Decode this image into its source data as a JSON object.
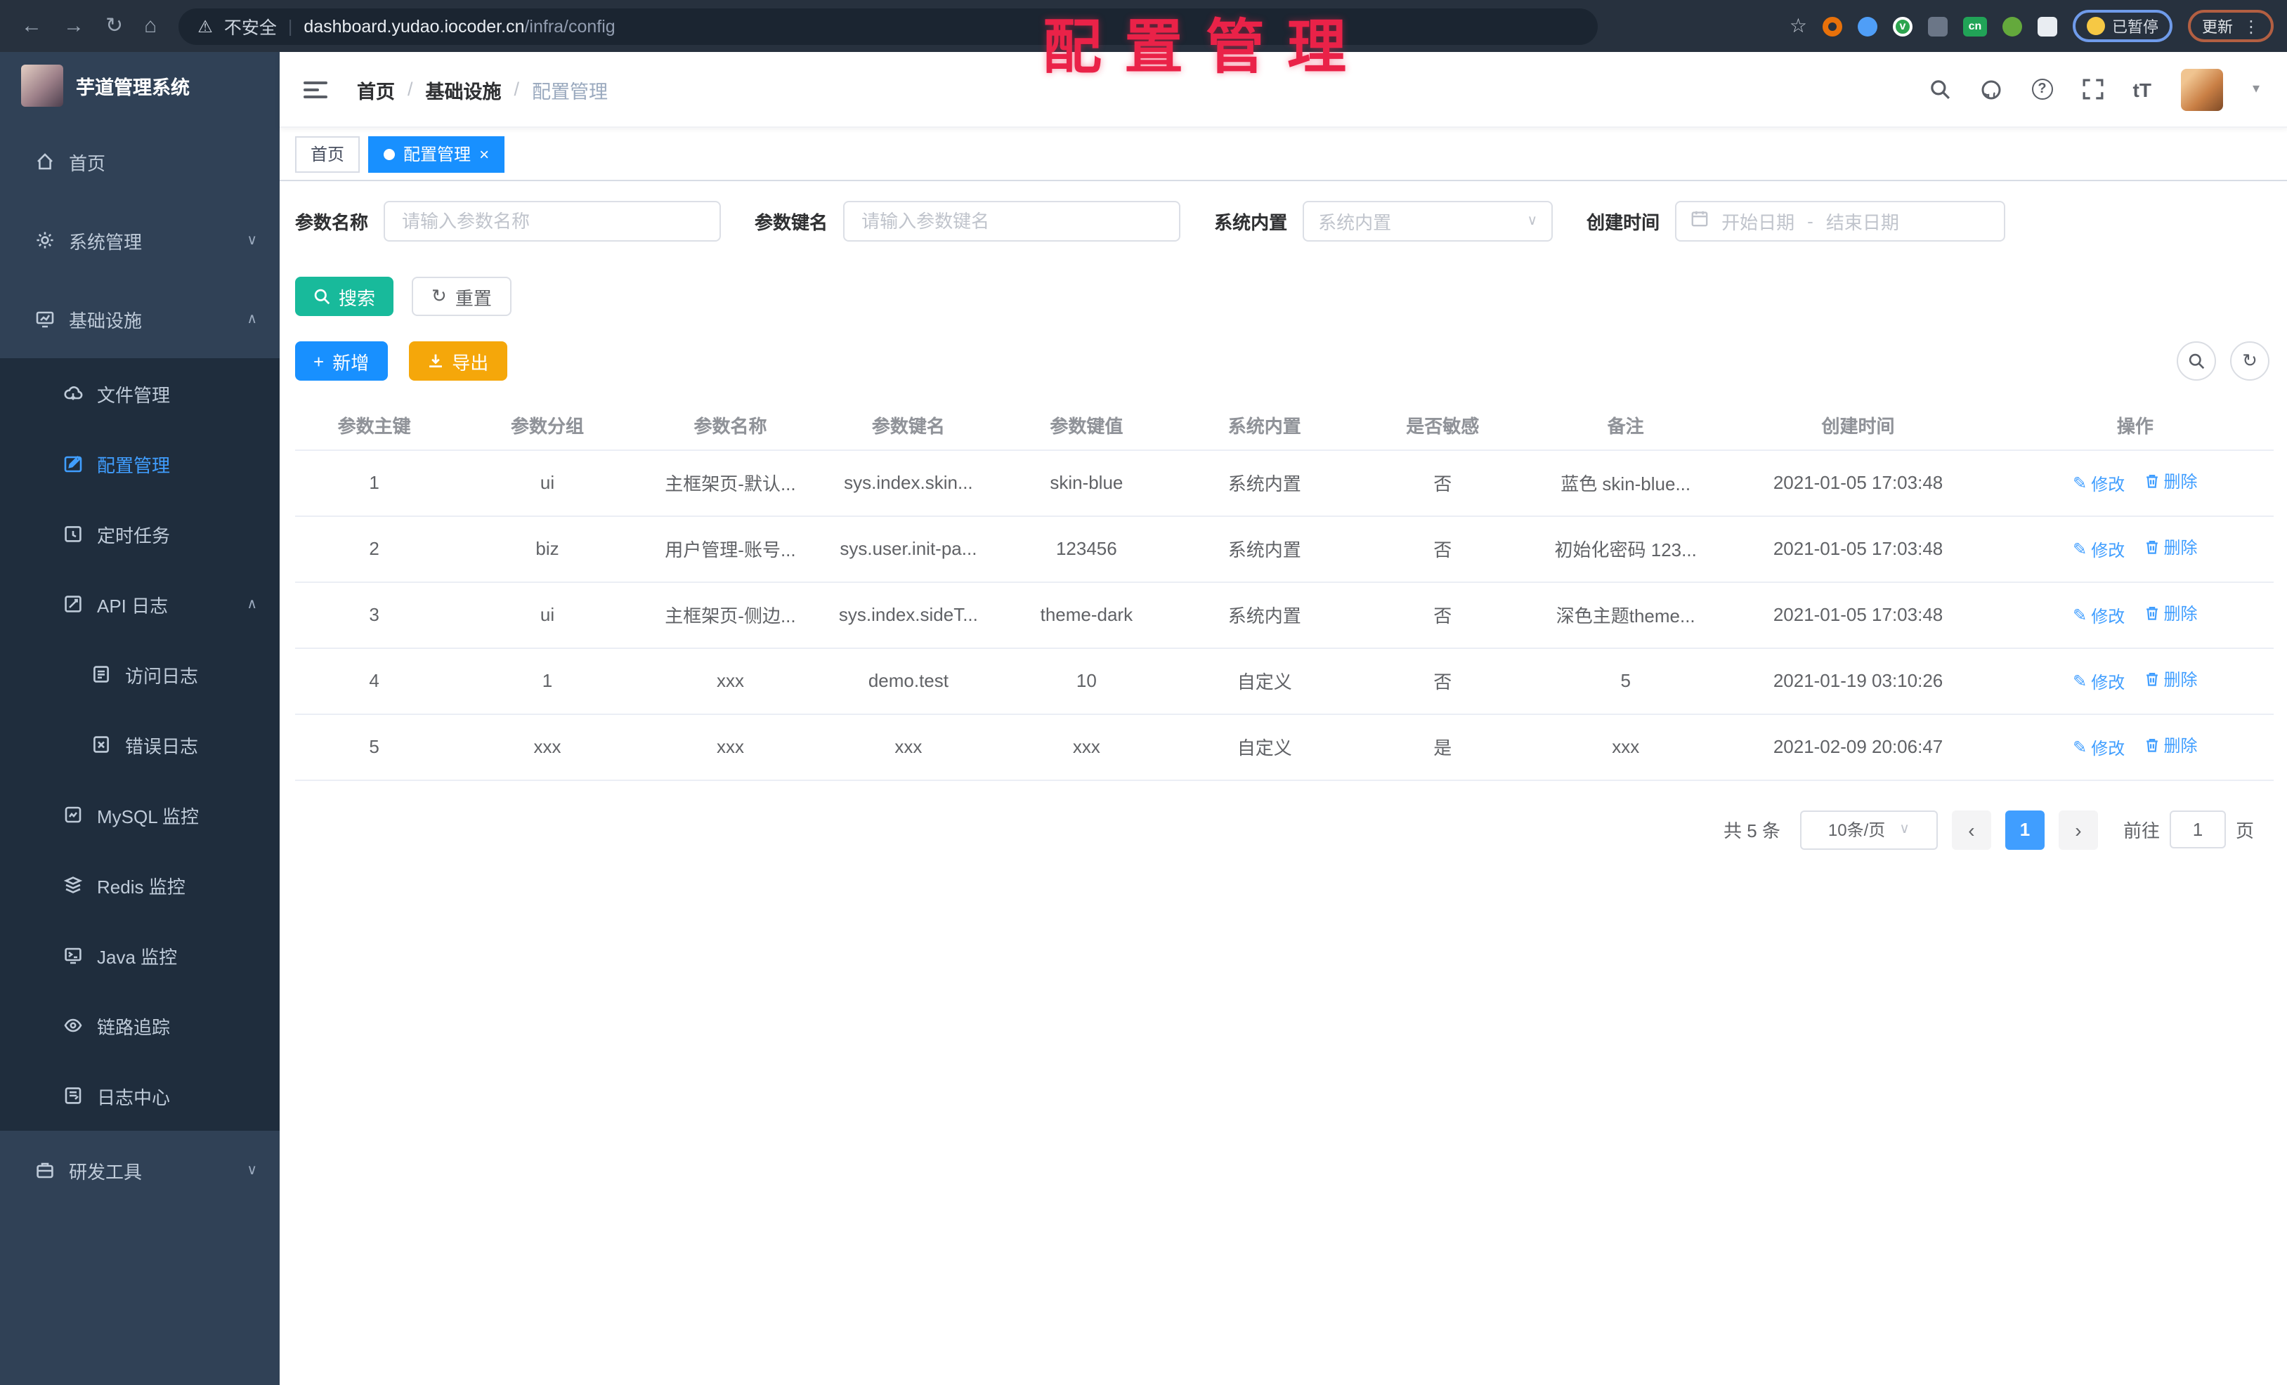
{
  "browser": {
    "security_label": "不安全",
    "url_host": "dashboard.yudao.iocoder.cn",
    "url_path": "/infra/config",
    "cn_badge": "cn",
    "paused_badge": "已暂停",
    "update_button": "更新"
  },
  "overlay": {
    "title": "配置管理"
  },
  "glyphs": {
    "back": "←",
    "forward": "→",
    "reload": "↻",
    "home": "⌂",
    "warning": "⚠",
    "pill_divider": "|",
    "star": "☆",
    "menu_dots": "⋮",
    "chevron_down": "∨",
    "chevron_up": "∧",
    "select_caret": "∨",
    "dropdown_caret": "▾",
    "prev": "‹",
    "next": "›",
    "close": "×",
    "plus": "+",
    "edit": "✎",
    "question": "?",
    "font_size": "tT",
    "breadcrumb_sep": "/",
    "check": "v"
  },
  "sidebar": {
    "app_title": "芋道管理系统",
    "items": [
      {
        "label": "首页"
      },
      {
        "label": "系统管理"
      },
      {
        "label": "基础设施"
      },
      {
        "label": "文件管理"
      },
      {
        "label": "配置管理"
      },
      {
        "label": "定时任务"
      },
      {
        "label": "API 日志"
      },
      {
        "label": "访问日志"
      },
      {
        "label": "错误日志"
      },
      {
        "label": "MySQL 监控"
      },
      {
        "label": "Redis 监控"
      },
      {
        "label": "Java 监控"
      },
      {
        "label": "链路追踪"
      },
      {
        "label": "日志中心"
      },
      {
        "label": "研发工具"
      }
    ]
  },
  "header": {
    "breadcrumb": [
      "首页",
      "基础设施",
      "配置管理"
    ]
  },
  "tabs": [
    {
      "label": "首页"
    },
    {
      "label": "配置管理"
    }
  ],
  "filters": {
    "name_label": "参数名称",
    "name_placeholder": "请输入参数名称",
    "key_label": "参数键名",
    "key_placeholder": "请输入参数键名",
    "type_label": "系统内置",
    "type_placeholder": "系统内置",
    "date_label": "创建时间",
    "date_start": "开始日期",
    "date_sep": "-",
    "date_end": "结束日期",
    "search_label": "搜索",
    "reset_label": "重置"
  },
  "toolbar": {
    "add_label": "新增",
    "export_label": "导出"
  },
  "table": {
    "columns": [
      "参数主键",
      "参数分组",
      "参数名称",
      "参数键名",
      "参数键值",
      "系统内置",
      "是否敏感",
      "备注",
      "创建时间",
      "操作"
    ],
    "edit_label": "修改",
    "delete_label": "删除",
    "rows": [
      {
        "id": "1",
        "group": "ui",
        "name": "主框架页-默认...",
        "key": "sys.index.skin...",
        "value": "skin-blue",
        "type": "系统内置",
        "sensitive": "否",
        "remark": "蓝色 skin-blue...",
        "created": "2021-01-05 17:03:48"
      },
      {
        "id": "2",
        "group": "biz",
        "name": "用户管理-账号...",
        "key": "sys.user.init-pa...",
        "value": "123456",
        "type": "系统内置",
        "sensitive": "否",
        "remark": "初始化密码 123...",
        "created": "2021-01-05 17:03:48"
      },
      {
        "id": "3",
        "group": "ui",
        "name": "主框架页-侧边...",
        "key": "sys.index.sideT...",
        "value": "theme-dark",
        "type": "系统内置",
        "sensitive": "否",
        "remark": "深色主题theme...",
        "created": "2021-01-05 17:03:48"
      },
      {
        "id": "4",
        "group": "1",
        "name": "xxx",
        "key": "demo.test",
        "value": "10",
        "type": "自定义",
        "sensitive": "否",
        "remark": "5",
        "created": "2021-01-19 03:10:26"
      },
      {
        "id": "5",
        "group": "xxx",
        "name": "xxx",
        "key": "xxx",
        "value": "xxx",
        "type": "自定义",
        "sensitive": "是",
        "remark": "xxx",
        "created": "2021-02-09 20:06:47"
      }
    ]
  },
  "pagination": {
    "total_text": "共 5 条",
    "page_size": "10条/页",
    "current_page": "1",
    "goto_label": "前往",
    "goto_value": "1",
    "page_suffix": "页"
  },
  "colors": {
    "accent_blue": "#1890ff",
    "link_blue": "#409eff",
    "search_teal": "#18ba9b",
    "export_orange": "#f5a70a",
    "sidebar_bg": "#304156",
    "submenu_bg": "#1f2d3d",
    "overlay_red": "#ea2248"
  }
}
